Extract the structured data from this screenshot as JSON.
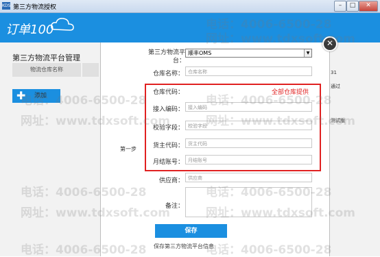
{
  "window": {
    "title": "第三方物流授权",
    "app_icon_text": "KDS",
    "min_label": "–",
    "max_label": "□",
    "close_label": "✕"
  },
  "header": {
    "logo": "订单100",
    "color": "#1b8fe0"
  },
  "background_page": {
    "title": "第三方物流平台管理",
    "column_header": "物流仓库名称",
    "add_button": "添加",
    "right_fragments": [
      "31",
      "通过",
      "测试版"
    ]
  },
  "modal": {
    "platform_label": "第三方物流平台：",
    "platform_value": "顺丰OMS",
    "warehouse_name_label": "仓库名称：",
    "warehouse_name_placeholder": "仓库名称",
    "warehouse_code_label": "仓库代码：",
    "access_code_label": "接入编码：",
    "access_code_placeholder": "接入编码",
    "check_field_label": "校验字段：",
    "check_field_placeholder": "校验字段",
    "owner_code_label": "货主代码：",
    "owner_code_placeholder": "货主代码",
    "monthly_account_label": "月结账号：",
    "monthly_account_placeholder": "月结账号",
    "supplier_label": "供应商：",
    "supplier_placeholder": "供应商",
    "remark_label": "备注：",
    "step_label": "第一步",
    "highlight_note": "全部仓库提供",
    "save_button": "保存",
    "save_hint": "保存第三方物流平台信息",
    "close_icon": "✕"
  },
  "watermark": {
    "phone": "电话：4006-6500-28",
    "site": "网址：www.tdxsoft.com"
  }
}
